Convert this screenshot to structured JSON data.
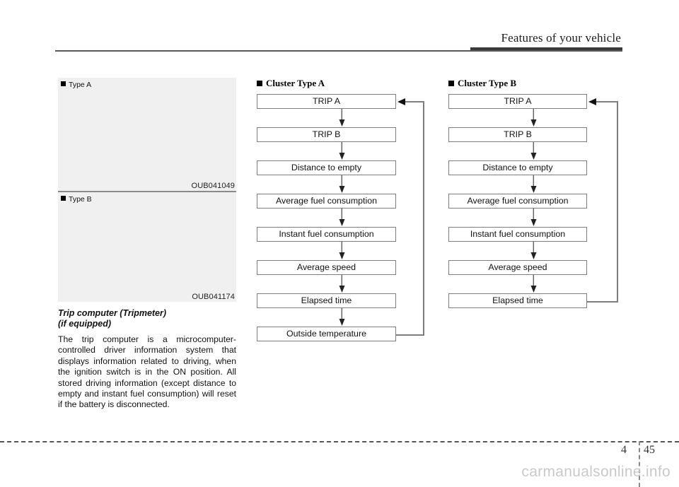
{
  "header": {
    "title": "Features of your vehicle"
  },
  "left_column": {
    "figure_a": {
      "label": "Type A",
      "code": "OUB041049"
    },
    "figure_b": {
      "label": "Type B",
      "code": "OUB041174"
    },
    "section_heading": "Trip computer (Tripmeter)\n(if equipped)",
    "body_paragraph": "The trip computer is a microcomputer-controlled driver information system that displays information related to driving, when the ignition switch is in the ON position. All stored driving information (except distance to empty and instant fuel consumption) will reset if the battery is disconnected."
  },
  "flow_a": {
    "title": "Cluster Type A",
    "steps": [
      "TRIP A",
      "TRIP B",
      "Distance to empty",
      "Average fuel consumption",
      "Instant fuel consumption",
      "Average speed",
      "Elapsed time",
      "Outside temperature"
    ]
  },
  "flow_b": {
    "title": "Cluster Type B",
    "steps": [
      "TRIP A",
      "TRIP B",
      "Distance to empty",
      "Average fuel consumption",
      "Instant fuel consumption",
      "Average speed",
      "Elapsed time"
    ]
  },
  "footer": {
    "chapter": "4",
    "page": "45",
    "watermark": "carmanualsonline.info"
  },
  "colors": {
    "box_border": "#7d7d7d",
    "rule_dark": "#3a3a3a",
    "rule_light": "#5a5a5a",
    "panel_fill": "#f0f0f0",
    "watermark": "#c9c9c9"
  }
}
